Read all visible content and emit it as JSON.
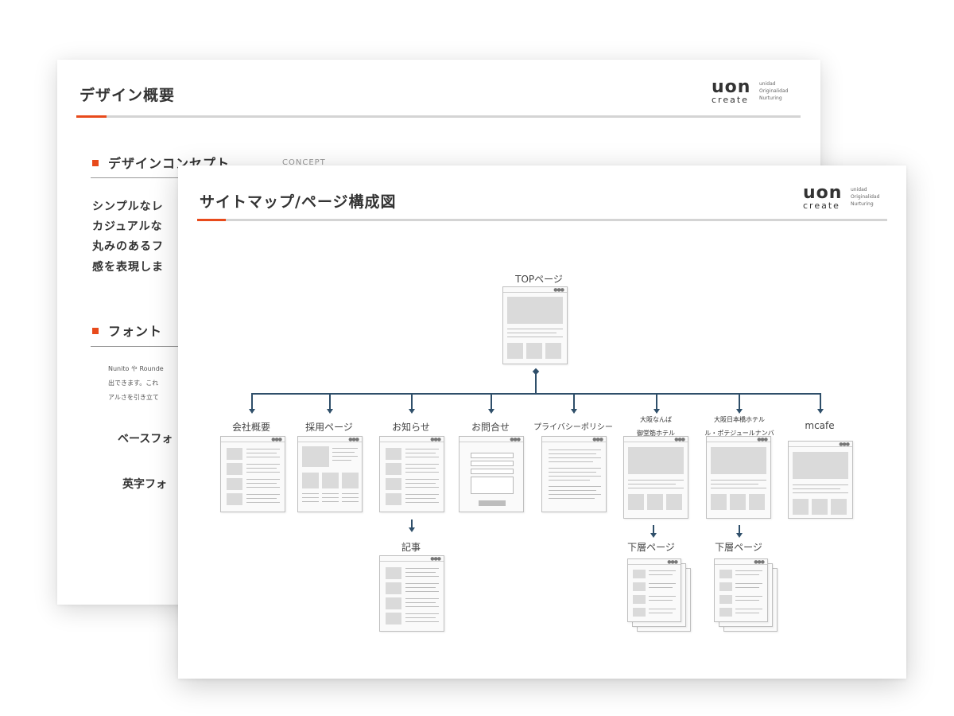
{
  "brand": {
    "logo_mark": "uon",
    "logo_sub": "create",
    "logo_tagline": [
      "unidad",
      "Originalidad",
      "Nurturing"
    ],
    "accent_color": "#e84a1b",
    "connector_color": "#2f4f6a"
  },
  "back_slide": {
    "title": "デザイン概要",
    "concept": {
      "heading": "デザインコンセプト",
      "tag": "CONCEPT",
      "lines": [
        "シンプルなレ",
        "カジュアルな",
        "丸みのあるフ",
        "感を表現しま"
      ]
    },
    "font": {
      "heading": "フォント",
      "lines": [
        "Nunito や Rounde",
        "出できます。これ",
        "アルさを引き立て"
      ],
      "base_font_label": "ベースフォ",
      "latin_font_label": "英字フォ"
    }
  },
  "front_slide": {
    "title": "サイトマップ/ページ構成図",
    "sitemap": {
      "root": "TOPページ",
      "children": [
        "会社概要",
        "採用ページ",
        "お知らせ",
        "お問合せ",
        "プライバシーポリシー",
        "大阪なんば\n御堂筋ホテル",
        "大阪日本橋ホテル\nル・ポテジュールナンバ",
        "mcafe"
      ],
      "sub_pages": {
        "article": "記事",
        "lower_page_1": "下層ページ",
        "lower_page_2": "下層ページ"
      }
    }
  }
}
